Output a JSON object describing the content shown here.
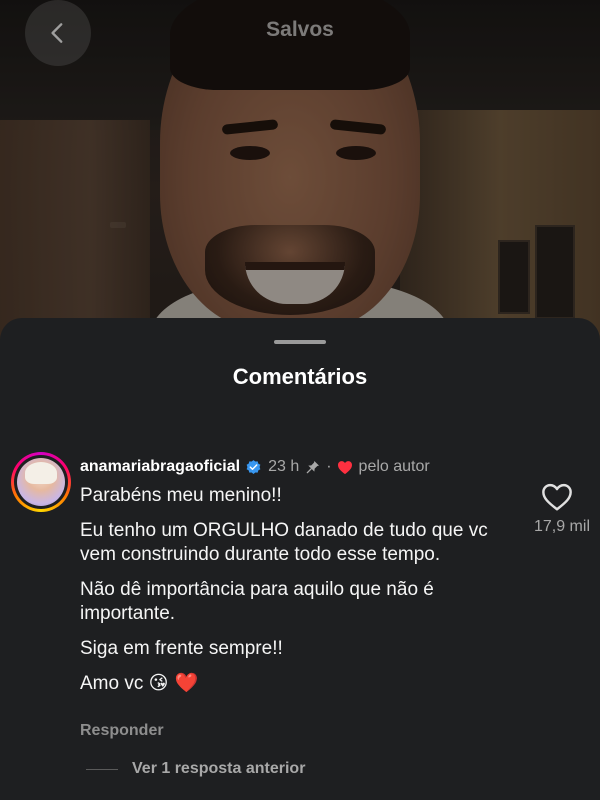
{
  "header": {
    "title": "Salvos"
  },
  "sheet": {
    "title": "Comentários"
  },
  "comment": {
    "username": "anamariabragaoficial",
    "time": "23 h",
    "separator": "·",
    "liked_by_author_label": "pelo autor",
    "paragraphs": [
      "Parabéns meu menino!!",
      "Eu tenho um ORGULHO danado de tudo que vc vem construindo durante todo esse tempo.",
      "Não dê importância para aquilo que não é importante.",
      "Siga em frente sempre!!"
    ],
    "last_line_text": "Amo vc",
    "last_line_emojis": "😘 ❤️",
    "like_count": "17,9 mil",
    "reply_label": "Responder",
    "view_replies_label": "Ver 1 resposta anterior"
  },
  "colors": {
    "sheet_background": "#1e1f21",
    "secondary_text": "#a8a8a8",
    "verified_blue": "#3897f0",
    "heart_red": "#ff3040"
  },
  "icons": {
    "back": "chevron-left-icon",
    "verified": "verified-badge-icon",
    "pinned": "pin-icon",
    "liked_by_author": "heart-filled-icon",
    "like": "heart-outline-icon"
  }
}
